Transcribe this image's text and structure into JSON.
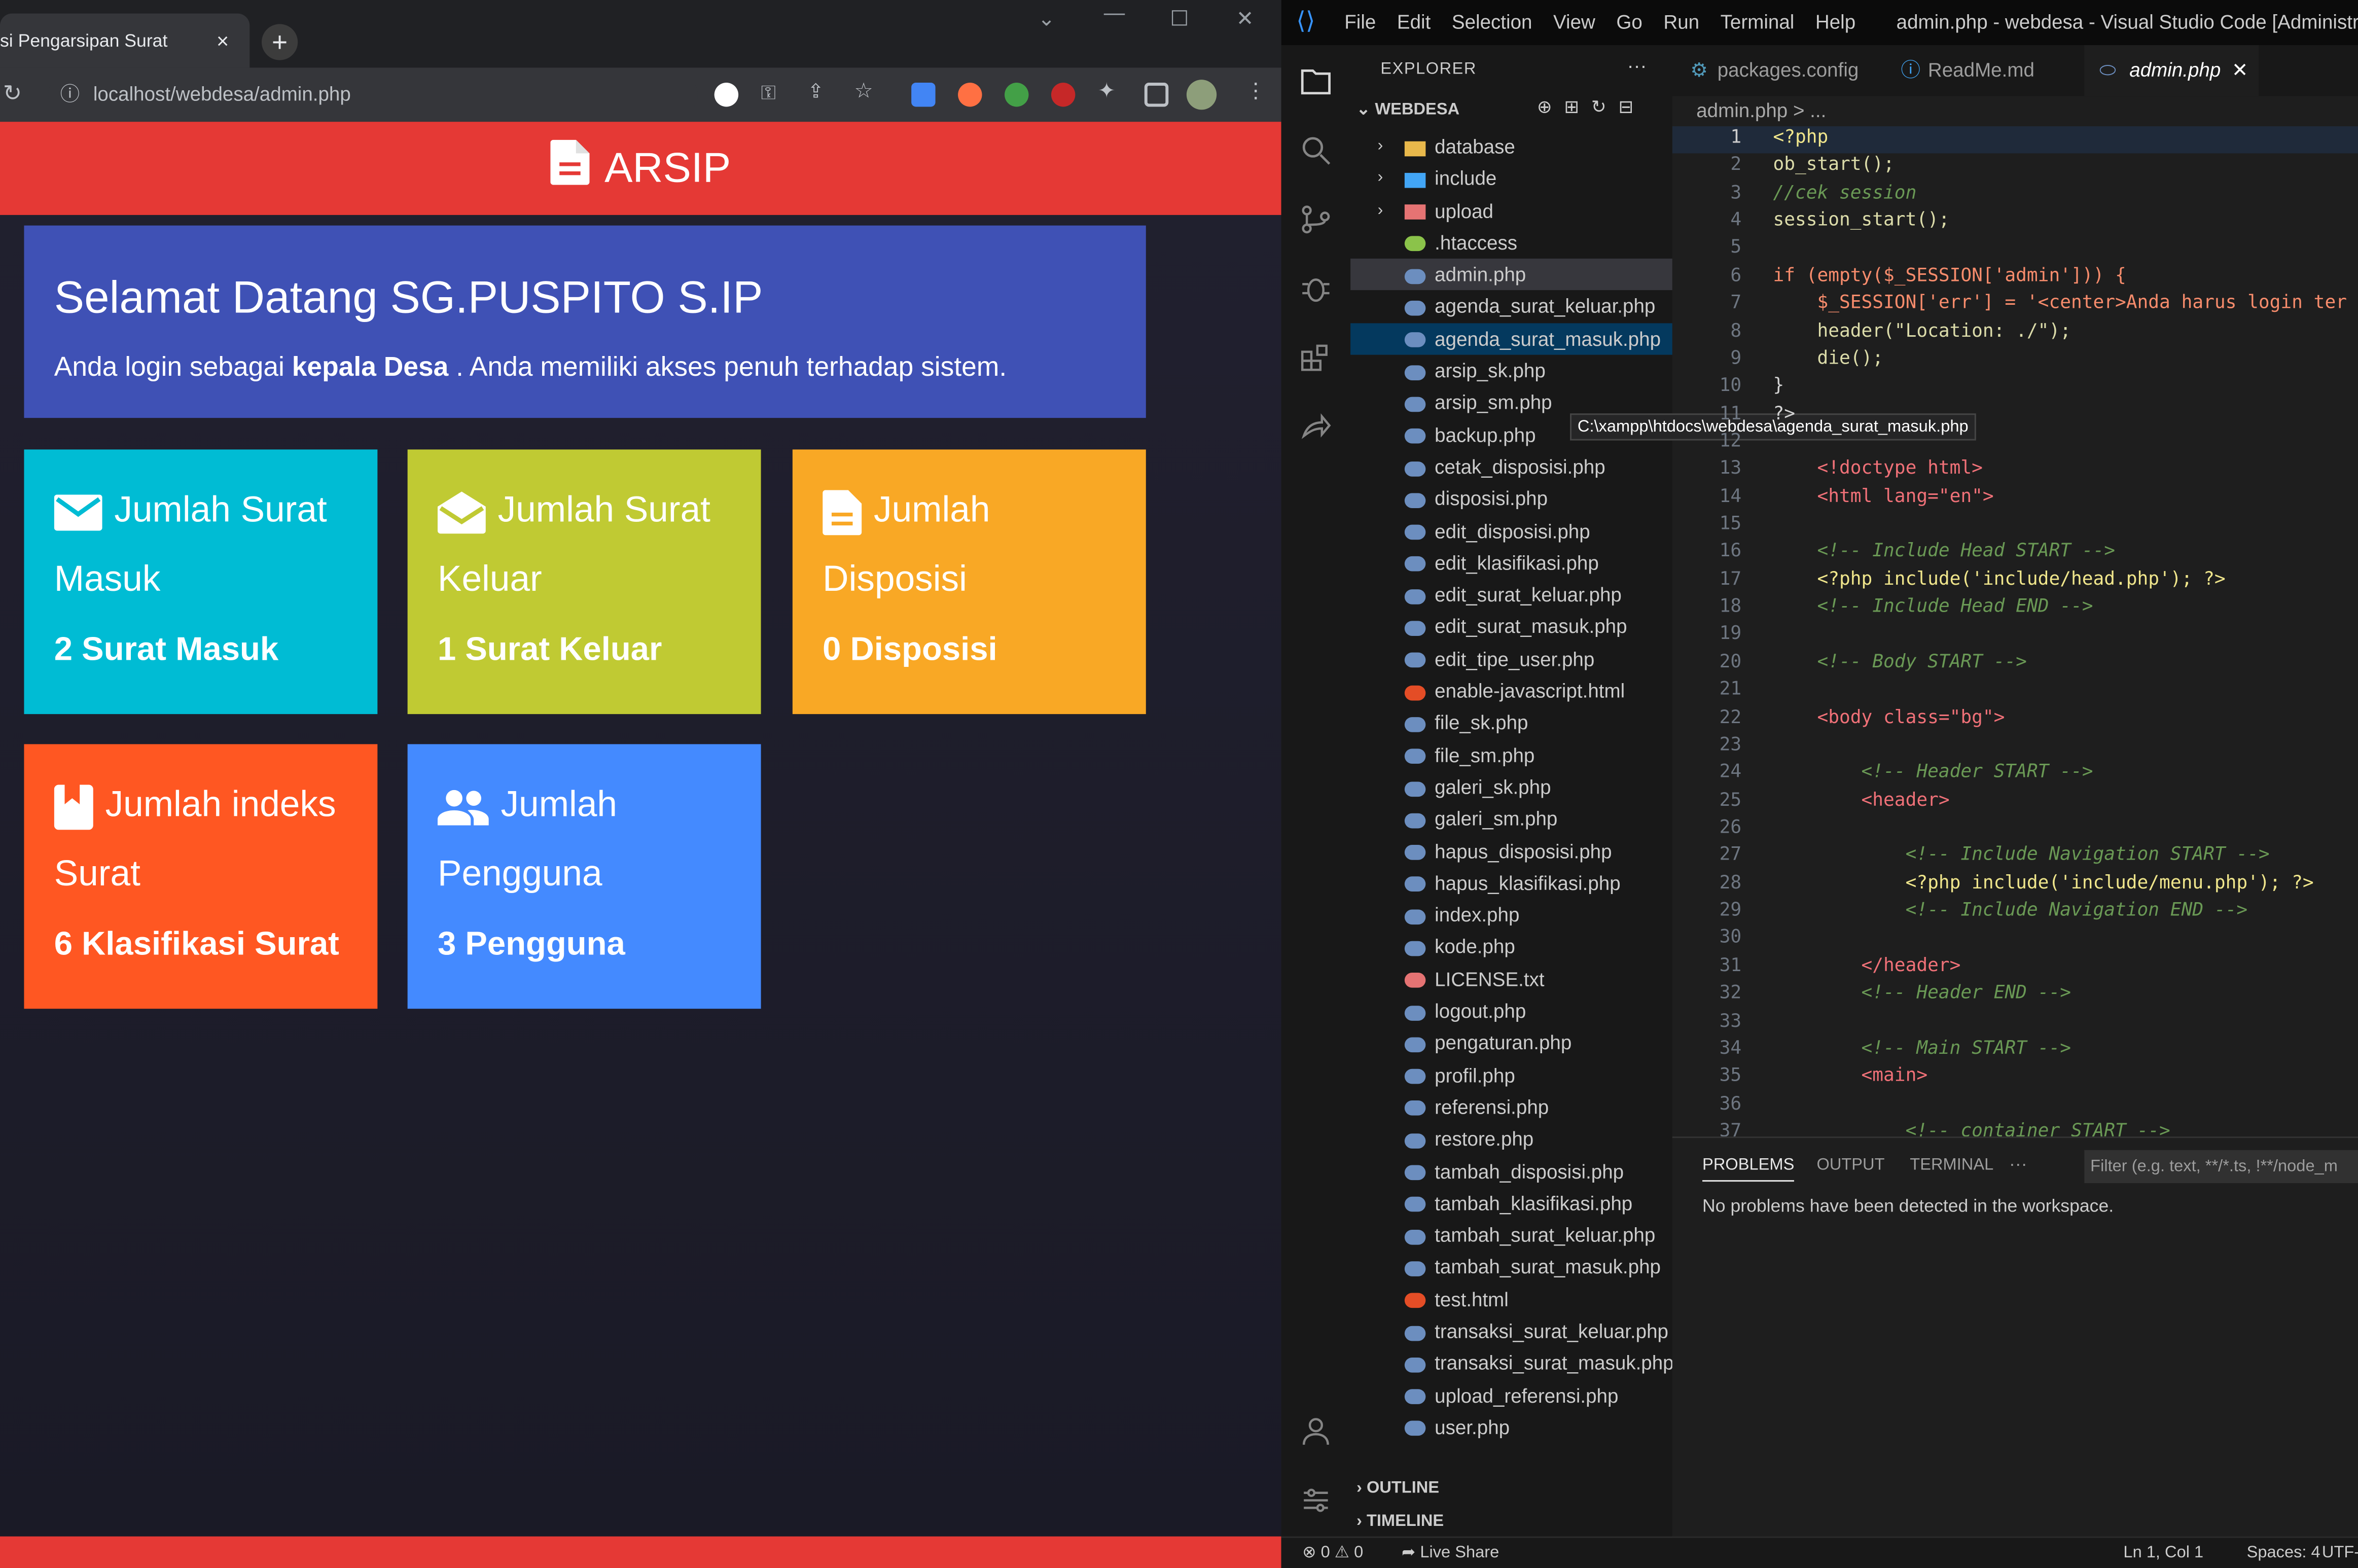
{
  "browser": {
    "tab_title": "si Pengarsipan Surat",
    "tab_close": "×",
    "new_tab": "+",
    "url": "localhost/webdesa/admin.php"
  },
  "app": {
    "header": "ARSIP",
    "header_color": "#e53935",
    "welcome_title": "Selamat Datang SG.PUSPITO S.IP",
    "welcome_pre": "Anda login sebagai ",
    "welcome_role": "kepala Desa",
    "welcome_post": " . Anda memiliki akses penuh terhadap sistem.",
    "cards": [
      {
        "l1": "Jumlah Surat",
        "l2": "Masuk",
        "l3": "2 Surat Masuk",
        "color": "#00bcd4",
        "icon": "mail-icon"
      },
      {
        "l1": "Jumlah Surat",
        "l2": "Keluar",
        "l3": "1 Surat Keluar",
        "color": "#c0ca33",
        "icon": "open-mail-icon"
      },
      {
        "l1": "Jumlah",
        "l2": "Disposisi",
        "l3": "0 Disposisi",
        "color": "#f9a825",
        "icon": "document-icon"
      },
      {
        "l1": "Jumlah indeks",
        "l2": "Surat",
        "l3": "6 Klasifikasi Surat",
        "color": "#ff5722",
        "icon": "bookmark-icon"
      },
      {
        "l1": "Jumlah",
        "l2": "Pengguna",
        "l3": "3 Pengguna",
        "color": "#448aff",
        "icon": "people-icon"
      }
    ]
  },
  "vscode": {
    "menu": [
      "File",
      "Edit",
      "Selection",
      "View",
      "Go",
      "Run",
      "Terminal",
      "Help"
    ],
    "window_title": "admin.php - webdesa - Visual Studio Code [Administra...",
    "explorer_title": "EXPLORER",
    "workspace": "WEBDESA",
    "folders": [
      "database",
      "include",
      "upload"
    ],
    "files": [
      ".htaccess",
      "admin.php",
      "agenda_surat_keluar.php",
      "agenda_surat_masuk.php",
      "arsip_sk.php",
      "arsip_sm.php",
      "backup.php",
      "cetak_disposisi.php",
      "disposisi.php",
      "edit_disposisi.php",
      "edit_klasifikasi.php",
      "edit_surat_keluar.php",
      "edit_surat_masuk.php",
      "edit_tipe_user.php",
      "enable-javascript.html",
      "file_sk.php",
      "file_sm.php",
      "galeri_sk.php",
      "galeri_sm.php",
      "hapus_disposisi.php",
      "hapus_klasifikasi.php",
      "index.php",
      "kode.php",
      "LICENSE.txt",
      "logout.php",
      "pengaturan.php",
      "profil.php",
      "referensi.php",
      "restore.php",
      "tambah_disposisi.php",
      "tambah_klasifikasi.php",
      "tambah_surat_keluar.php",
      "tambah_surat_masuk.php",
      "test.html",
      "transaksi_surat_keluar.php",
      "transaksi_surat_masuk.php",
      "upload_referensi.php",
      "user.php"
    ],
    "tooltip": "C:\\xampp\\htdocs\\webdesa\\agenda_surat_masuk.php",
    "outline": "OUTLINE",
    "timeline": "TIMELINE",
    "tabs": [
      "packages.config",
      "ReadMe.md",
      "admin.php"
    ],
    "breadcrumb": "admin.php > ...",
    "code_lines": [
      {
        "n": "1",
        "t": "<?php"
      },
      {
        "n": "2",
        "t": "ob_start();"
      },
      {
        "n": "3",
        "t": "//cek session"
      },
      {
        "n": "4",
        "t": "session_start();"
      },
      {
        "n": "5",
        "t": ""
      },
      {
        "n": "6",
        "t": "if (empty($_SESSION['admin'])) {"
      },
      {
        "n": "7",
        "t": "    $_SESSION['err'] = '<center>Anda harus login ter"
      },
      {
        "n": "8",
        "t": "    header(\"Location: ./\");"
      },
      {
        "n": "9",
        "t": "    die();"
      },
      {
        "n": "10",
        "t": "}"
      },
      {
        "n": "11",
        "t": "?>"
      },
      {
        "n": "12",
        "t": ""
      },
      {
        "n": "13",
        "t": "    <!doctype html>"
      },
      {
        "n": "14",
        "t": "    <html lang=\"en\">"
      },
      {
        "n": "15",
        "t": ""
      },
      {
        "n": "16",
        "t": "    <!-- Include Head START -->"
      },
      {
        "n": "17",
        "t": "    <?php include('include/head.php'); ?>"
      },
      {
        "n": "18",
        "t": "    <!-- Include Head END -->"
      },
      {
        "n": "19",
        "t": ""
      },
      {
        "n": "20",
        "t": "    <!-- Body START -->"
      },
      {
        "n": "21",
        "t": ""
      },
      {
        "n": "22",
        "t": "    <body class=\"bg\">"
      },
      {
        "n": "23",
        "t": ""
      },
      {
        "n": "24",
        "t": "        <!-- Header START -->"
      },
      {
        "n": "25",
        "t": "        <header>"
      },
      {
        "n": "26",
        "t": ""
      },
      {
        "n": "27",
        "t": "            <!-- Include Navigation START -->"
      },
      {
        "n": "28",
        "t": "            <?php include('include/menu.php'); ?>"
      },
      {
        "n": "29",
        "t": "            <!-- Include Navigation END -->"
      },
      {
        "n": "30",
        "t": ""
      },
      {
        "n": "31",
        "t": "        </header>"
      },
      {
        "n": "32",
        "t": "        <!-- Header END -->"
      },
      {
        "n": "33",
        "t": ""
      },
      {
        "n": "34",
        "t": "        <!-- Main START -->"
      },
      {
        "n": "35",
        "t": "        <main>"
      },
      {
        "n": "36",
        "t": ""
      },
      {
        "n": "37",
        "t": "            <!-- container START -->"
      }
    ],
    "panel_tabs": [
      "PROBLEMS",
      "OUTPUT",
      "TERMINAL",
      "···"
    ],
    "filter_placeholder": "Filter (e.g. text, **/*.ts, !**/node_m",
    "problems_msg": "No problems have been detected in the workspace.",
    "status_left": "⊗ 0 ⚠ 0",
    "status_liveshare": "Live Share",
    "status_pos": "Ln 1, Col 1",
    "status_spaces": "Spaces: 4",
    "status_enc": "UTF-"
  }
}
